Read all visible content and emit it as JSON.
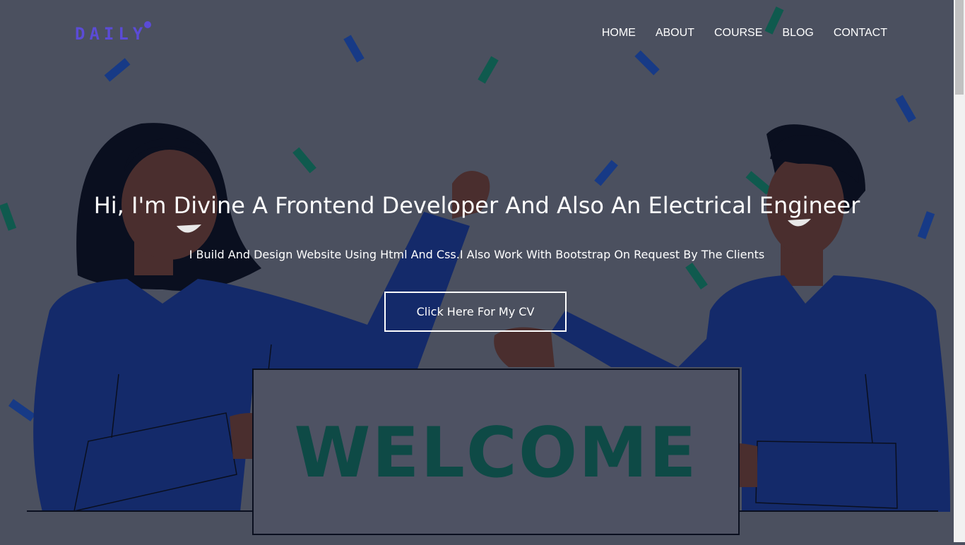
{
  "header": {
    "logo_text": "DAILY",
    "nav": [
      {
        "label": "HOME"
      },
      {
        "label": "ABOUT"
      },
      {
        "label": "COURSE"
      },
      {
        "label": "BLOG"
      },
      {
        "label": "CONTACT"
      }
    ]
  },
  "hero": {
    "title": "Hi, I'm Divine A Frontend Developer And Also An Electrical Engineer",
    "subtitle": "I Build And Design Website Using Html And Css.I Also Work With Bootstrap On Request By The Clients",
    "cta_label": "Click Here For My CV",
    "sign_text": "WELCOME"
  },
  "colors": {
    "background": "#4b505f",
    "accent_logo": "#5b4bd6",
    "shirt": "#142a6a",
    "confetti_blue": "#173a86",
    "confetti_green": "#0f5a4e",
    "sign_text": "#0e4a46"
  }
}
